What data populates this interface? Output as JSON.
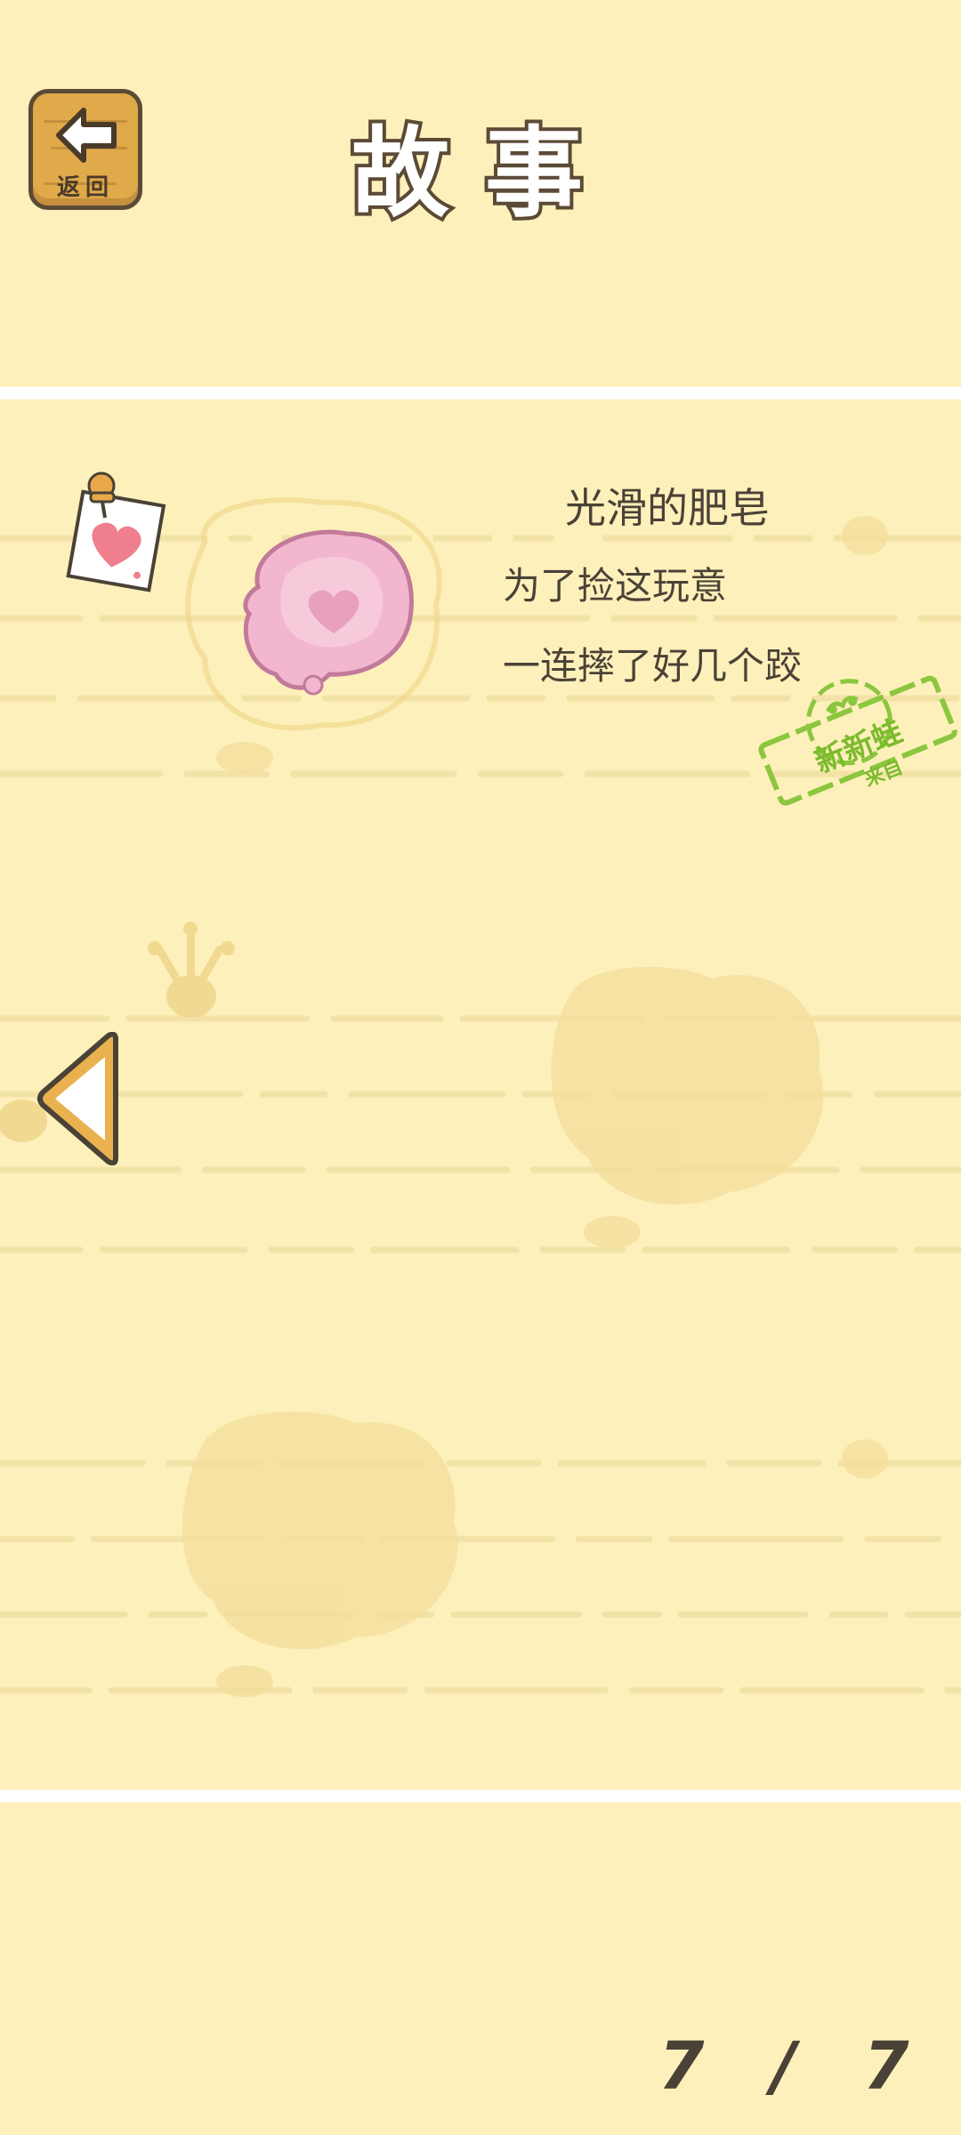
{
  "header": {
    "back_label": "返回",
    "title": "故事"
  },
  "story": {
    "item_name": "光滑的肥皂",
    "lines": [
      "为了捡这玩意",
      "一连摔了好几个跤"
    ],
    "stamp": {
      "main": "新新蛙",
      "sub": "来自"
    }
  },
  "pagination": {
    "current": "7",
    "separator": "/",
    "total": "7"
  },
  "colors": {
    "background": "#fdf0bb",
    "board_line": "#f3e0a0",
    "text": "#4a4236",
    "stamp_green": "#7dbb2e",
    "soap_pink": "#f2b6cf"
  },
  "icons": {
    "back": "back-arrow-icon",
    "prev": "left-triangle-arrow-icon",
    "pin_note": "pinned-heart-note-icon",
    "soap": "pink-heart-soap-icon",
    "footprint": "frog-footprint-icon"
  }
}
